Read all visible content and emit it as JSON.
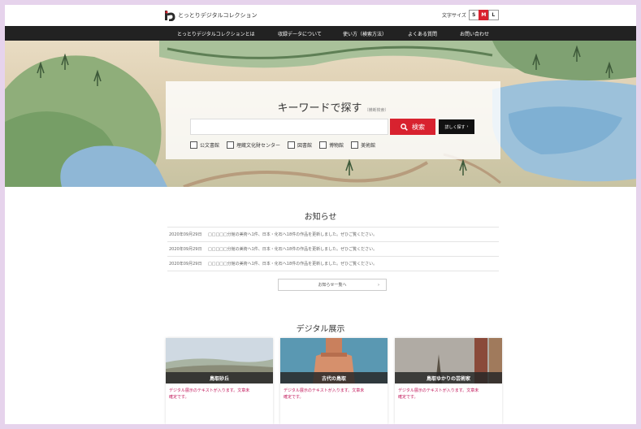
{
  "header": {
    "site_title": "とっとりデジタルコレクション",
    "font_size_label": "文字サイズ",
    "font_sizes": [
      "S",
      "M",
      "L"
    ],
    "active_font_size": "M"
  },
  "nav": {
    "items": [
      "とっとりデジタルコレクションとは",
      "収録データについて",
      "使い方（検索方法）",
      "よくある質問",
      "お問い合わせ"
    ]
  },
  "search": {
    "title": "キーワードで探す",
    "title_note": "（横断検索）",
    "input_value": "",
    "search_button": "検索",
    "advanced_button": "詳しく探す",
    "filters": [
      "公文書館",
      "埋蔵文化財センター",
      "図書館",
      "博物館",
      "美術館"
    ]
  },
  "news": {
    "title": "お知らせ",
    "items": [
      {
        "date": "2020年09月29日",
        "text": "□□□□□分館の美術へ1件、日本・化石へ18件の作品を更新しました。ぜひご覧ください。"
      },
      {
        "date": "2020年09月29日",
        "text": "□□□□□分館の美術へ1件、日本・化石へ18件の作品を更新しました。ぜひご覧ください。"
      },
      {
        "date": "2020年09月29日",
        "text": "□□□□□分館の美術へ1件、日本・化石へ18件の作品を更新しました。ぜひご覧ください。"
      }
    ],
    "more_label": "お知らせ一覧へ",
    "more_arrow": "›"
  },
  "exhibits": {
    "title": "デジタル展示",
    "cards": [
      {
        "label": "鳥取砂丘",
        "text": "デジタル展示のテキストが入ります。文章未確定です。"
      },
      {
        "label": "古代の鳥取",
        "text": "デジタル展示のテキストが入ります。文章未確定です。"
      },
      {
        "label": "鳥取ゆかりの芸術家",
        "text": "デジタル展示のテキストが入ります。文章未確定です。"
      }
    ]
  },
  "colors": {
    "accent": "#d8222f",
    "nav_bg": "#222222",
    "card_text": "#c2185b",
    "frame": "#e6d3ec"
  }
}
